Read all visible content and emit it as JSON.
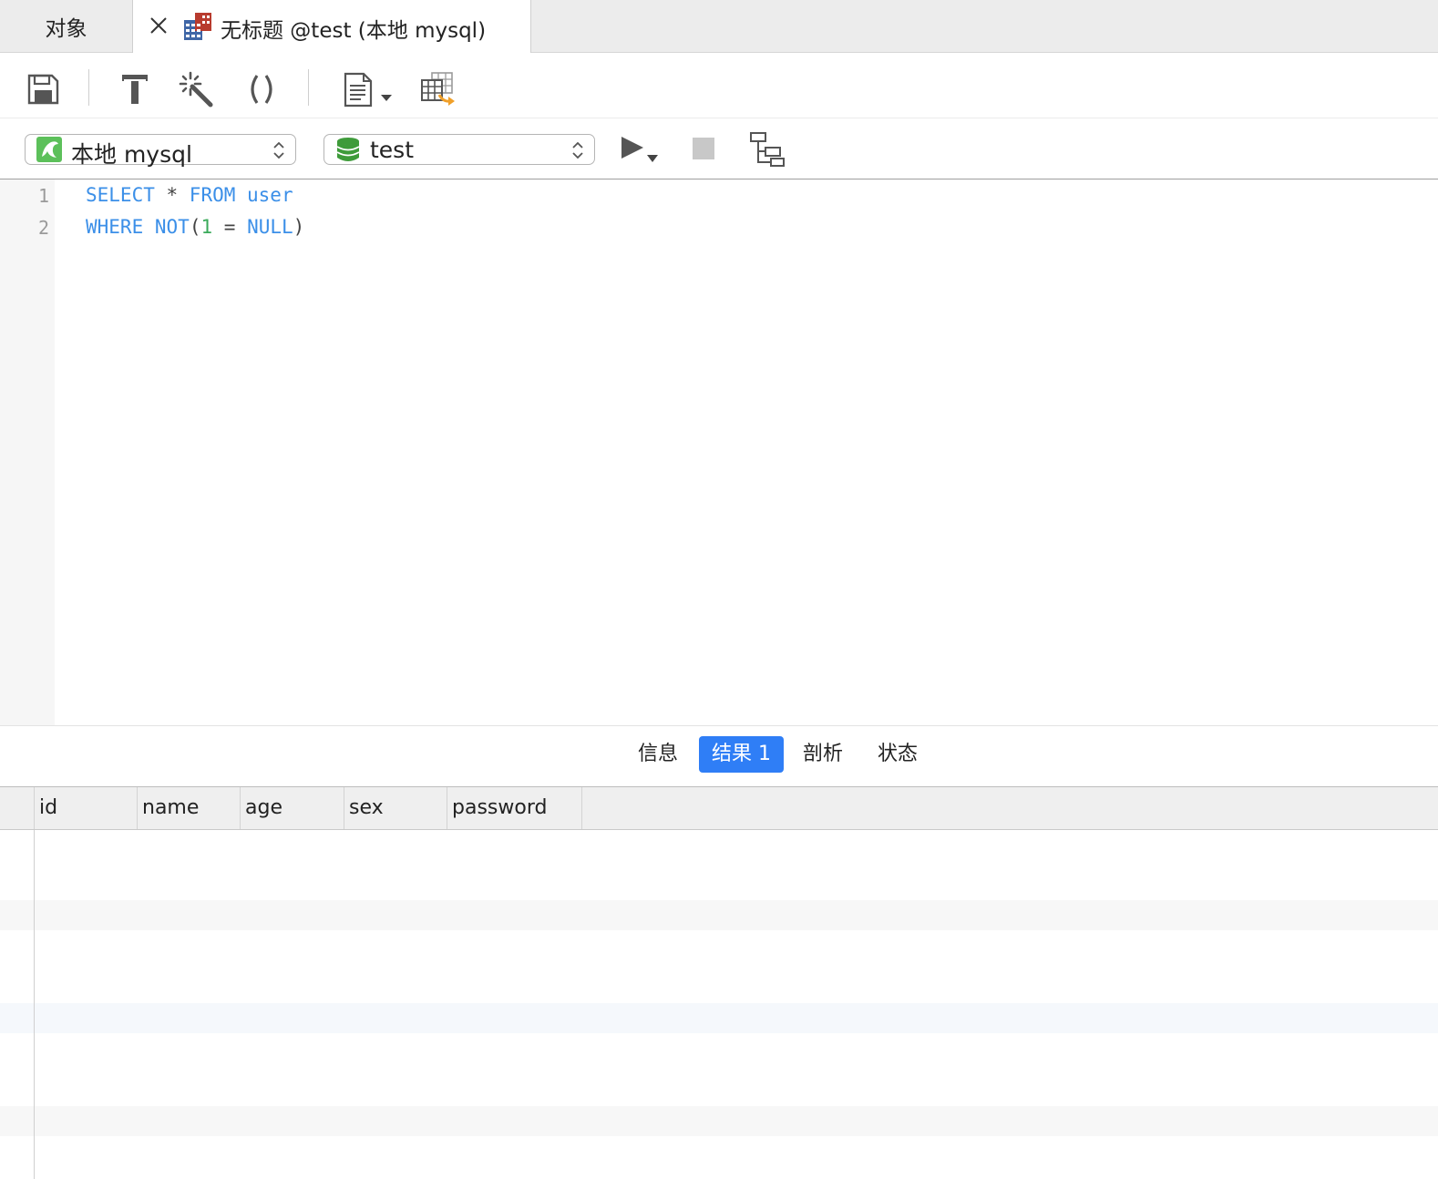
{
  "tabs": {
    "objects_label": "对象",
    "query_title": "无标题 @test (本地 mysql)"
  },
  "connection": {
    "selected": "本地 mysql",
    "icon": "mysql-dolphin-icon",
    "accent": "#5cc05a"
  },
  "database": {
    "selected": "test",
    "icon": "database-icon",
    "accent": "#3e9b3a"
  },
  "editor": {
    "lines": [
      {
        "number": "1",
        "tokens": [
          {
            "t": "SELECT",
            "c": "kw"
          },
          {
            "t": " * ",
            "c": "op"
          },
          {
            "t": "FROM",
            "c": "kw"
          },
          {
            "t": " user",
            "c": "kw"
          }
        ]
      },
      {
        "number": "2",
        "tokens": [
          {
            "t": "WHERE",
            "c": "kw"
          },
          {
            "t": " ",
            "c": "op"
          },
          {
            "t": "NOT",
            "c": "kw"
          },
          {
            "t": "(",
            "c": "op"
          },
          {
            "t": "1",
            "c": "num"
          },
          {
            "t": " = ",
            "c": "op"
          },
          {
            "t": "NULL",
            "c": "kw"
          },
          {
            "t": ")",
            "c": "op"
          }
        ]
      }
    ]
  },
  "result_tabs": [
    {
      "label": "信息",
      "active": false
    },
    {
      "label": "结果 1",
      "active": true
    },
    {
      "label": "剖析",
      "active": false
    },
    {
      "label": "状态",
      "active": false
    }
  ],
  "grid": {
    "columns": [
      "id",
      "name",
      "age",
      "sex",
      "password"
    ]
  },
  "colors": {
    "keyword": "#3b8fe8",
    "number": "#3aaa5a",
    "active_tab": "#2f7ef6"
  }
}
